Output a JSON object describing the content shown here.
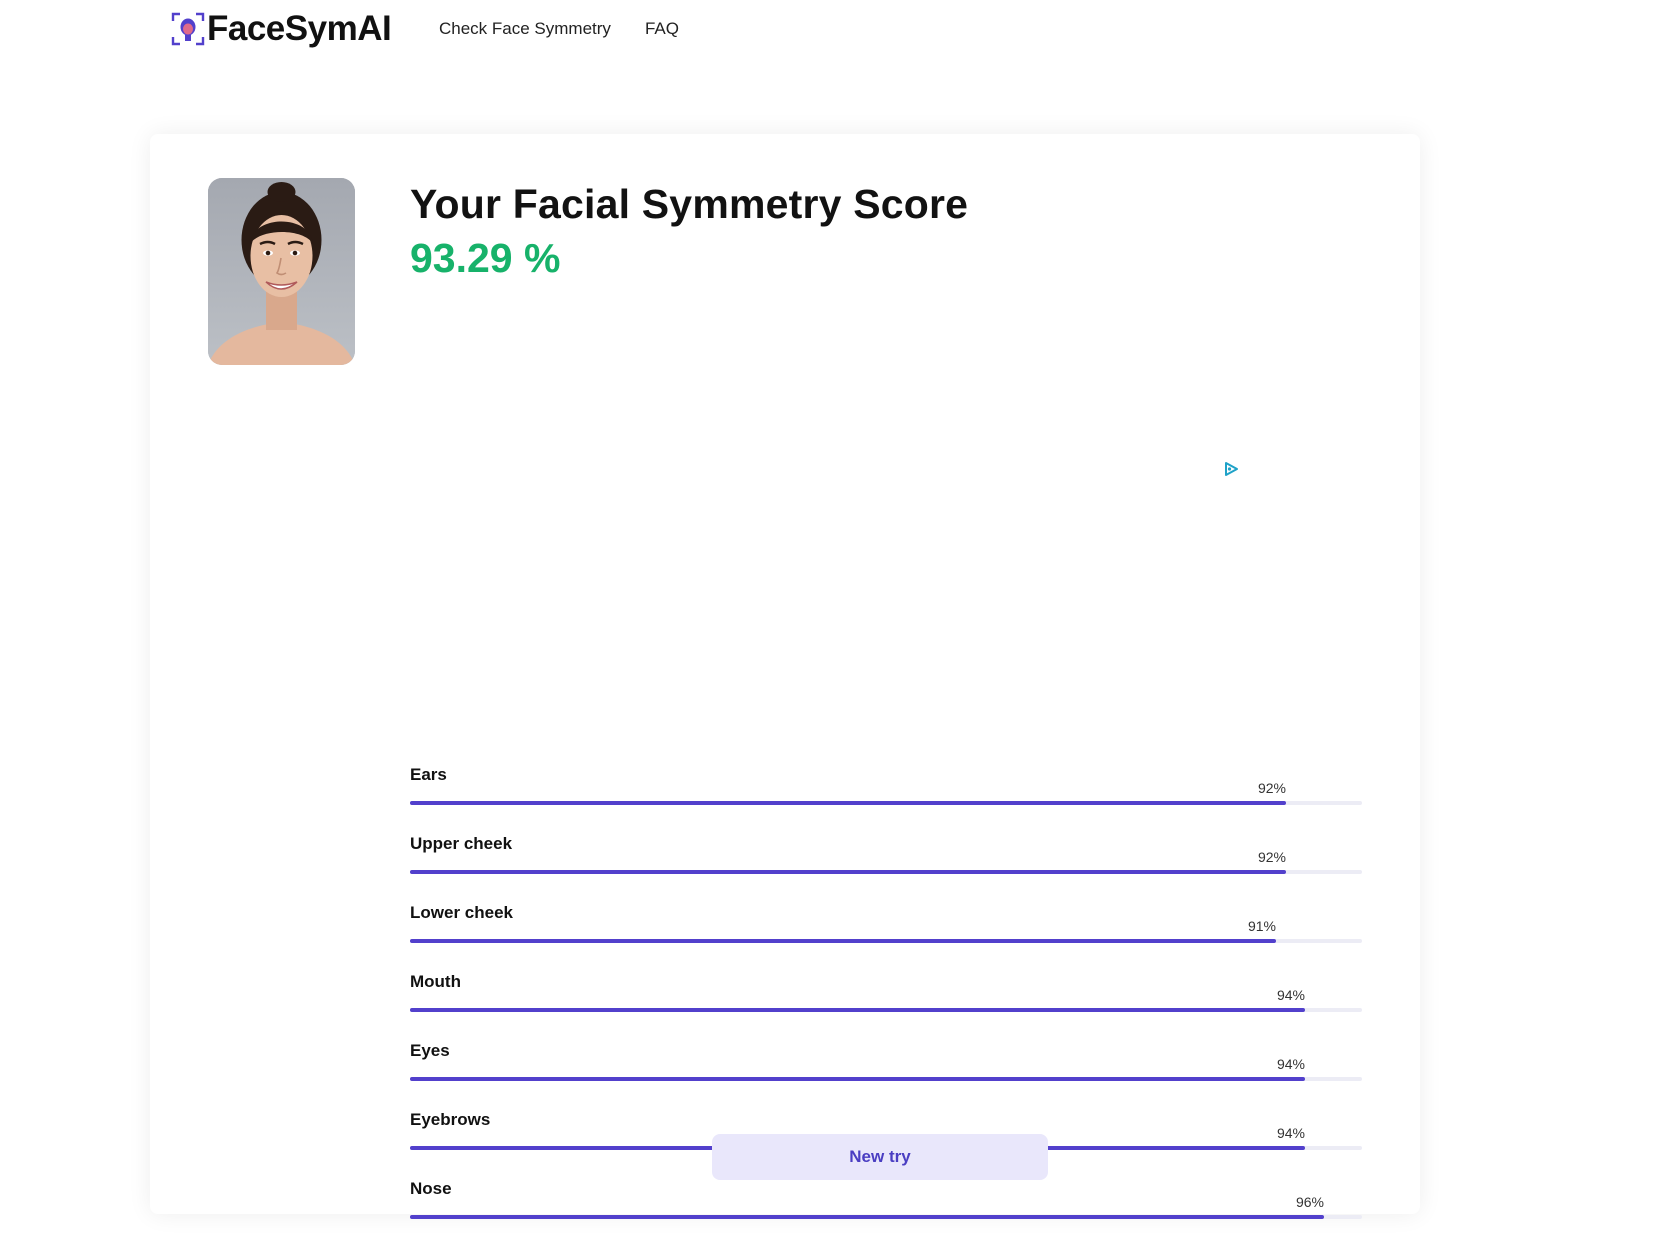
{
  "brand": {
    "name": "FaceSymAI",
    "icon": "face-scan-icon",
    "accent": "#5240cc"
  },
  "nav": {
    "items": [
      {
        "label": "Check Face Symmetry"
      },
      {
        "label": "FAQ"
      }
    ]
  },
  "result": {
    "title": "Your Facial Symmetry Score",
    "score": "93.29 %",
    "score_color": "#17b26a",
    "photo_icon": "face-photo"
  },
  "ad": {
    "icon": "ad-choices-icon"
  },
  "metrics": [
    {
      "label": "Ears",
      "value": "92%",
      "percent": 92
    },
    {
      "label": "Upper cheek",
      "value": "92%",
      "percent": 92
    },
    {
      "label": "Lower cheek",
      "value": "91%",
      "percent": 91
    },
    {
      "label": "Mouth",
      "value": "94%",
      "percent": 94
    },
    {
      "label": "Eyes",
      "value": "94%",
      "percent": 94
    },
    {
      "label": "Eyebrows",
      "value": "94%",
      "percent": 94
    },
    {
      "label": "Nose",
      "value": "96%",
      "percent": 96
    }
  ],
  "actions": {
    "new_try_label": "New try"
  }
}
